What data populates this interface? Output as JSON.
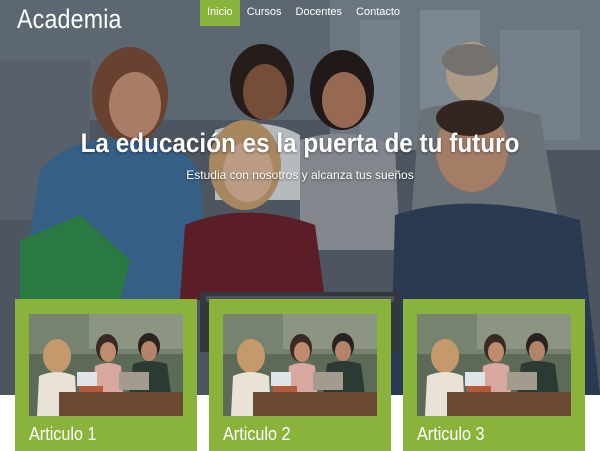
{
  "site": {
    "logo": "Academia"
  },
  "nav": {
    "items": [
      {
        "label": "Inicio",
        "active": true
      },
      {
        "label": "Cursos",
        "active": false
      },
      {
        "label": "Docentes",
        "active": false
      },
      {
        "label": "Contacto",
        "active": false
      }
    ]
  },
  "hero": {
    "title": "La educación es la puerta de tu futuro",
    "subtitle": "Estudia con nosotros y alcanza tus sueños"
  },
  "cards": [
    {
      "title": "Articulo 1"
    },
    {
      "title": "Articulo 2"
    },
    {
      "title": "Articulo 3"
    }
  ],
  "colors": {
    "accent": "#8ab33c",
    "text": "#ffffff"
  }
}
